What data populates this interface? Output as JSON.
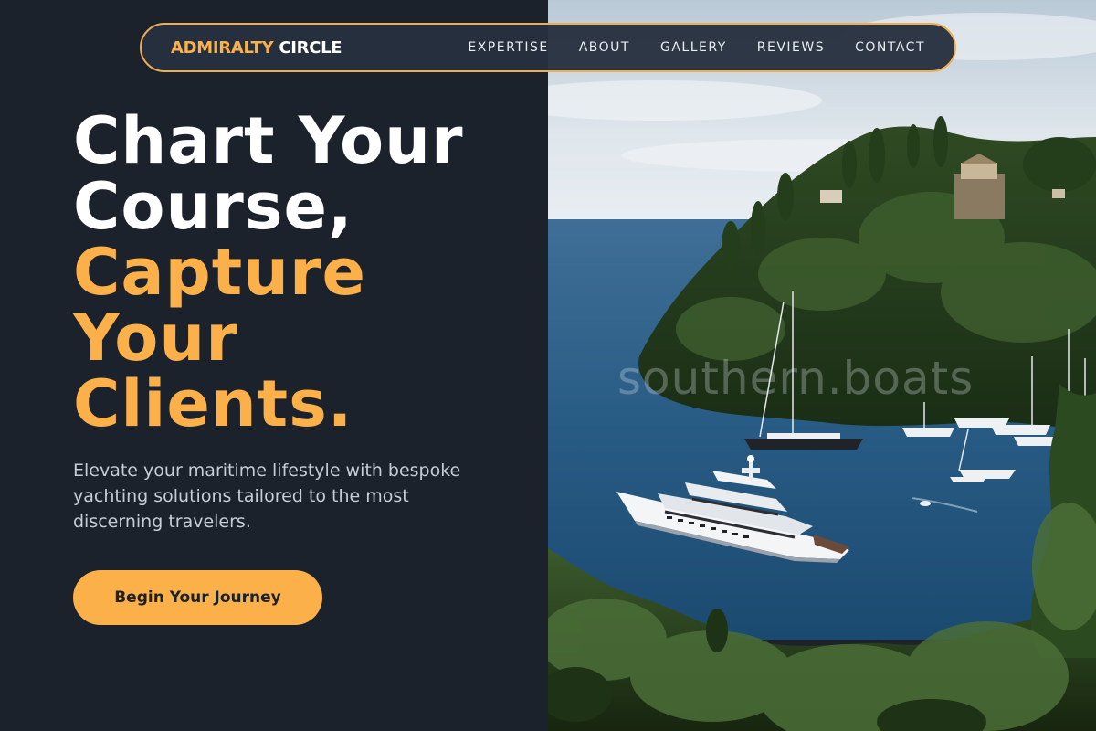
{
  "brand": {
    "part1": "ADMIRALTY",
    "part2": "CIRCLE"
  },
  "nav": {
    "items": [
      {
        "label": "EXPERTISE"
      },
      {
        "label": "ABOUT"
      },
      {
        "label": "GALLERY"
      },
      {
        "label": "REVIEWS"
      },
      {
        "label": "CONTACT"
      }
    ]
  },
  "hero": {
    "headline_white": [
      "Chart Your",
      "Course,"
    ],
    "headline_gold": [
      "Capture",
      "Your",
      "Clients."
    ],
    "subtitle": "Elevate your maritime lifestyle with bespoke yachting solutions tailored to the most discerning travelers.",
    "cta_label": "Begin Your Journey",
    "image_watermark": "southern.boats"
  },
  "colors": {
    "accent": "#fbb04a",
    "background": "#1c222b",
    "navbar": "#26303e",
    "text_light": "#c7cdd6"
  }
}
